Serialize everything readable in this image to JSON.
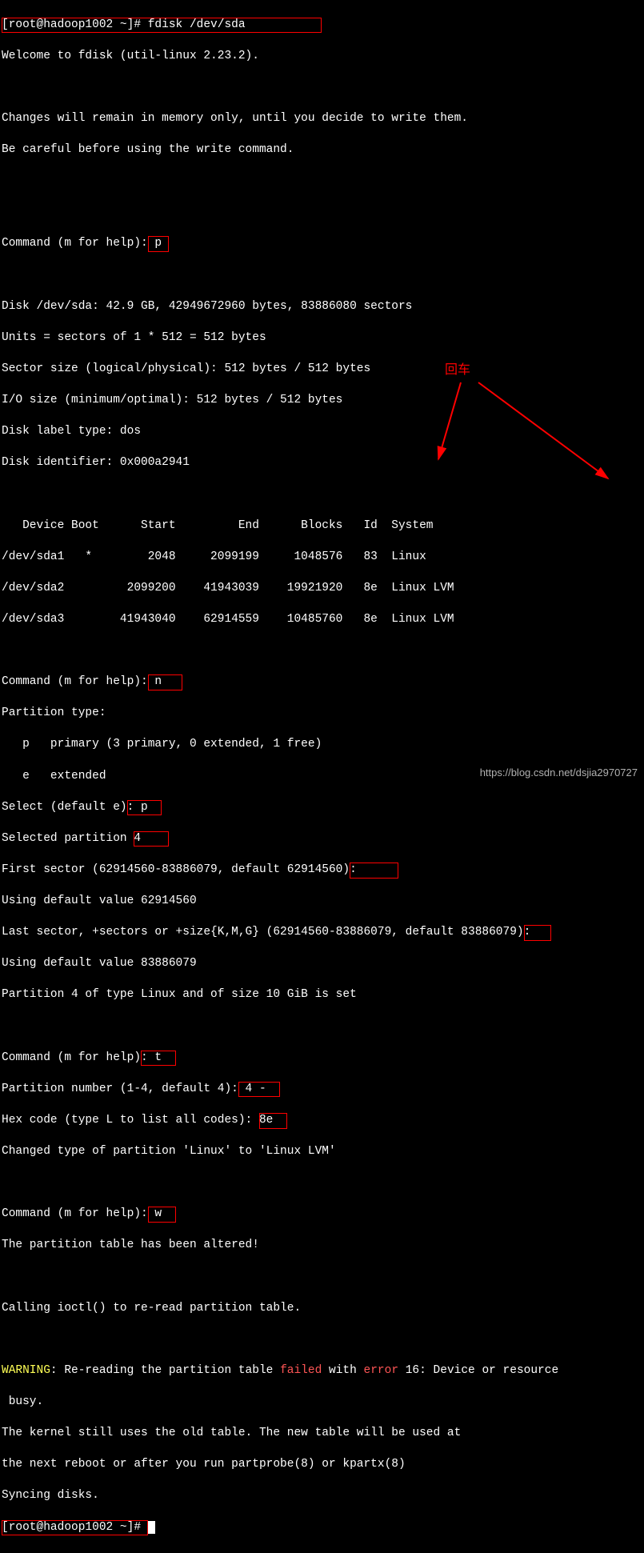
{
  "prompt1": "[root@hadoop1002 ~]# ",
  "cmd1": "fdisk /dev/sda",
  "welcome": "Welcome to fdisk (util-linux 2.23.2).",
  "changes1": "Changes will remain in memory only, until you decide to write them.",
  "changes2": "Be careful before using the write command.",
  "cmd_p_label": "Command (m for help):",
  "cmd_p_val": " p ",
  "disk_line": "Disk /dev/sda: 42.9 GB, 42949672960 bytes, 83886080 sectors",
  "units": "Units = sectors of 1 * 512 = 512 bytes",
  "sector_size": "Sector size (logical/physical): 512 bytes / 512 bytes",
  "io_size": "I/O size (minimum/optimal): 512 bytes / 512 bytes",
  "disk_label": "Disk label type: dos",
  "disk_id": "Disk identifier: 0x000a2941",
  "table_header": "   Device Boot      Start         End      Blocks   Id  System",
  "table_r1": "/dev/sda1   *        2048     2099199     1048576   83  Linux",
  "table_r2": "/dev/sda2         2099200    41943039    19921920   8e  Linux LVM",
  "table_r3": "/dev/sda3        41943040    62914559    10485760   8e  Linux LVM",
  "cmd_n_label": "Command (m for help):",
  "cmd_n_val": " n   ",
  "part_type": "Partition type:",
  "primary": "   p   primary (3 primary, 0 extended, 1 free)",
  "extended": "   e   extended",
  "select_label": "Select (default e)",
  "select_val": ": p  ",
  "selected_part_label": "Selected partition ",
  "selected_part_val": "4    ",
  "first_sector_label": "First sector (62914560-83886079, default 62914560)",
  "first_sector_box": ":      ",
  "using_default1": "Using default value 62914560",
  "last_sector_label": "Last sector, +sectors or +size{K,M,G} (62914560-83886079, default 83886079)",
  "last_sector_box": ":   ",
  "using_default2": "Using default value 83886079",
  "part4_set": "Partition 4 of type Linux and of size 10 GiB is set",
  "cmd_t_label": "Command (m for help)",
  "cmd_t_val": ": t  ",
  "part_num_label": "Partition number (1-4, default 4):",
  "part_num_val": " 4 -  ",
  "hex_label": "Hex code (type L to list all codes): ",
  "hex_val": "8e  ",
  "changed_type": "Changed type of partition 'Linux' to 'Linux LVM'",
  "cmd_w_label": "Command (m for help):",
  "cmd_w_val": " w  ",
  "altered": "The partition table has been altered!",
  "ioctl": "Calling ioctl() to re-read partition table.",
  "warn_label": "WARNING",
  "warn_mid1": ": Re-reading the partition table ",
  "warn_failed": "failed",
  "warn_mid2": " with ",
  "warn_error": "error",
  "warn_mid3": " 16: Device or resource",
  "warn_busy": " busy.",
  "kernel1": "The kernel still uses the old table. The new table will be used at",
  "kernel2": "the next reboot or after you run partprobe(8) or kpartx(8)",
  "syncing": "Syncing disks.",
  "prompt2": "[root@hadoop1002 ~]# ",
  "anno_enter": "回车",
  "watermark": "https://blog.csdn.net/dsjia2970727"
}
